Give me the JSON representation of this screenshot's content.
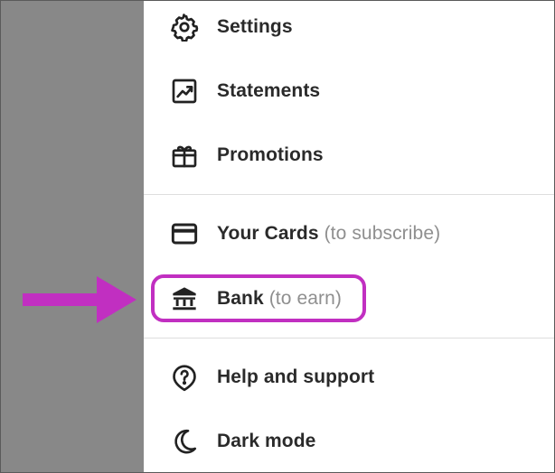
{
  "menu": {
    "items": [
      {
        "id": "settings",
        "label": "Settings",
        "hint": "",
        "icon": "gear-icon"
      },
      {
        "id": "statements",
        "label": "Statements",
        "hint": "",
        "icon": "chart-line-icon"
      },
      {
        "id": "promotions",
        "label": "Promotions",
        "hint": "",
        "icon": "gift-icon"
      },
      {
        "id": "your-cards",
        "label": "Your Cards",
        "hint": "(to subscribe)",
        "icon": "credit-card-icon"
      },
      {
        "id": "bank",
        "label": "Bank",
        "hint": "(to earn)",
        "icon": "bank-icon"
      },
      {
        "id": "help",
        "label": "Help and support",
        "hint": "",
        "icon": "help-icon"
      },
      {
        "id": "dark-mode",
        "label": "Dark mode",
        "hint": "",
        "icon": "moon-icon"
      }
    ]
  },
  "annotation": {
    "highlighted_item": "bank",
    "color": "#c12fc1"
  },
  "colors": {
    "backdrop": "#888888",
    "text": "#2a2a2a",
    "hint": "#8f8f8f",
    "divider": "#dedede"
  }
}
